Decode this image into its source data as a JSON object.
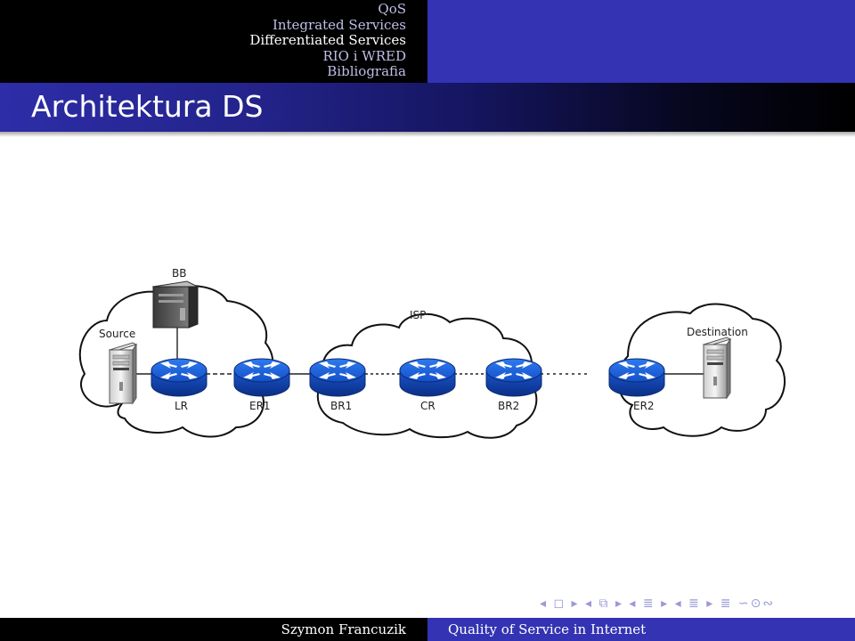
{
  "nav": {
    "sections": [
      "QoS",
      "Integrated Services",
      "Differentiated Services",
      "RIO i WRED",
      "Bibliografia"
    ]
  },
  "slide": {
    "title": "Architektura DS"
  },
  "diagram": {
    "cloud_label": "ISP",
    "server_label": "BB",
    "source_label": "Source",
    "destination_label": "Destination",
    "routers": [
      "LR",
      "ER1",
      "BR1",
      "CR",
      "BR2",
      "ER2"
    ]
  },
  "beamer_nav": {
    "symbols": "◂ ◻ ▸  ◂ ⧉ ▸  ◂ ≣ ▸  ◂ ≣ ▸   ≣   ∽⊙∾"
  },
  "footer": {
    "author": "Szymon Francuzik",
    "title": "Quality of Service in Internet"
  },
  "colors": {
    "router": "#1f63d8",
    "header_blue": "#3333b3",
    "title_dark": "#000000"
  }
}
